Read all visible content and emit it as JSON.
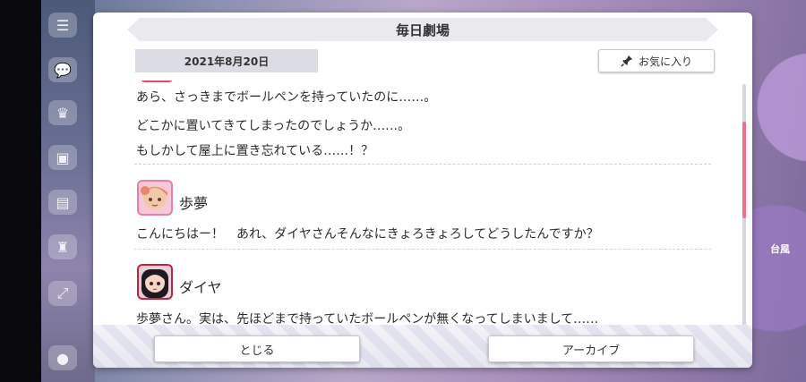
{
  "dialog": {
    "title": "毎日劇場",
    "date": "2021年8月20日",
    "favorite_label": "お気に入り",
    "close_label": "とじる",
    "archive_label": "アーカイブ"
  },
  "story": {
    "intro_lines": [
      "あら、さっきまでボールペンを持っていたのに……。",
      "どこかに置いてきてしまったのでしょうか……。",
      "もしかして屋上に置き忘れている……！？"
    ],
    "entries": [
      {
        "speaker": "歩夢",
        "text": "こんにちはー！　あれ、ダイヤさんそんなにきょろきょろしてどうしたんですか？"
      },
      {
        "speaker": "ダイヤ",
        "text": "歩夢さん。実は、先ほどまで持っていたボールペンが無くなってしまいまして……"
      }
    ]
  },
  "background": {
    "badge_label": "台風"
  },
  "colors": {
    "accent": "#f06e8a",
    "ayumu_frame": "#e77fa8",
    "dia_frame": "#c0243f"
  },
  "scroll_position": 0.2
}
